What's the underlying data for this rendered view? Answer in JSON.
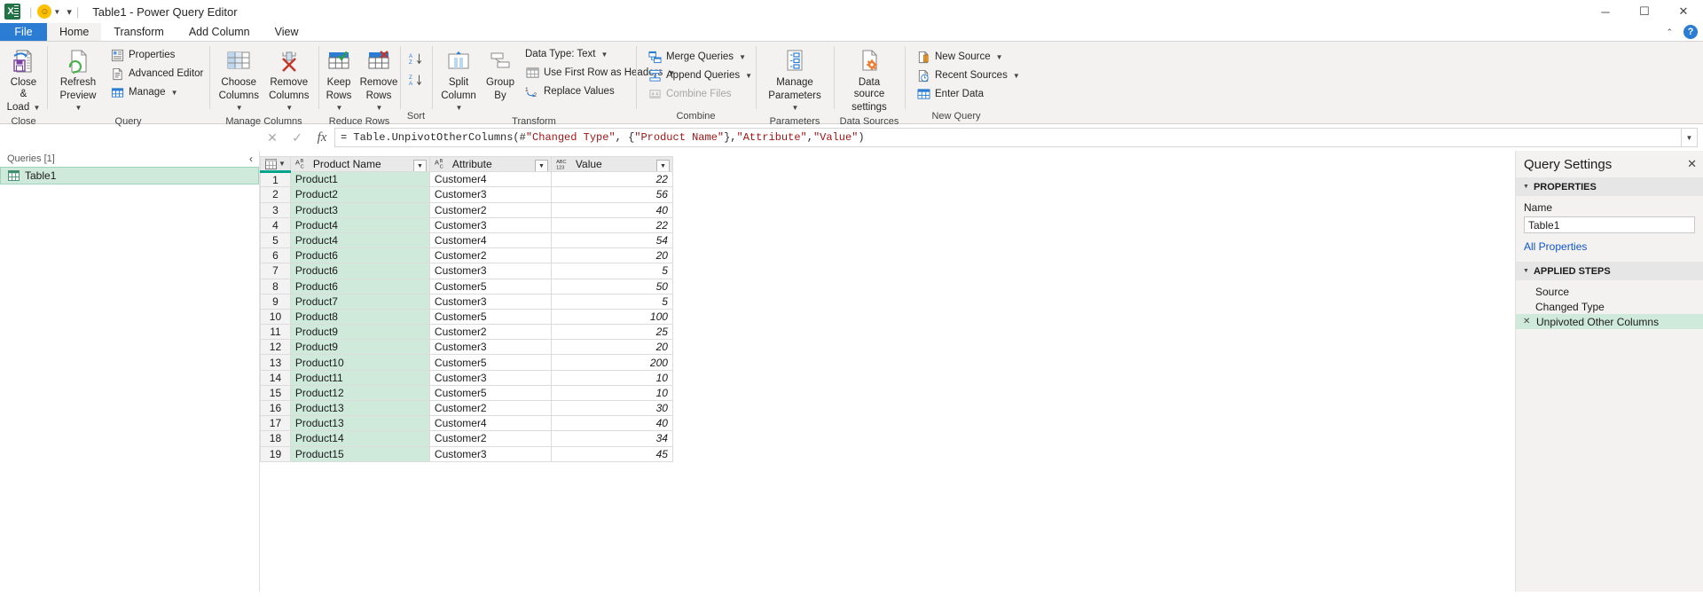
{
  "window": {
    "title": "Table1 - Power Query Editor",
    "app_icon": "excel-icon",
    "qat": {
      "autosave_icon": "smiley-icon",
      "customize_icon": "chevron-down-icon"
    },
    "buttons": {
      "minimize": "─",
      "maximize": "☐",
      "close": "✕"
    }
  },
  "tabs": [
    {
      "id": "file",
      "label": "File"
    },
    {
      "id": "home",
      "label": "Home"
    },
    {
      "id": "transform",
      "label": "Transform"
    },
    {
      "id": "add-column",
      "label": "Add Column"
    },
    {
      "id": "view",
      "label": "View"
    }
  ],
  "tabstrip_right": {
    "collapse": "⌃",
    "help": "?"
  },
  "ribbon": {
    "groups": [
      {
        "name": "Close",
        "label": "Close",
        "big": [
          {
            "label_line1": "Close &",
            "label_line2": "Load",
            "icon": "close-and-load-icon",
            "dropdown": true
          }
        ],
        "small": []
      },
      {
        "name": "Query",
        "label": "Query",
        "big": [
          {
            "label_line1": "Refresh",
            "label_line2": "Preview",
            "icon": "refresh-preview-icon",
            "dropdown": true
          }
        ],
        "small": [
          {
            "label": "Properties",
            "icon": "properties-icon",
            "dropdown": false
          },
          {
            "label": "Advanced Editor",
            "icon": "advanced-editor-icon",
            "dropdown": false
          },
          {
            "label": "Manage",
            "icon": "manage-icon",
            "dropdown": true
          }
        ]
      },
      {
        "name": "Manage Columns",
        "label": "Manage Columns",
        "big": [
          {
            "label_line1": "Choose",
            "label_line2": "Columns",
            "icon": "choose-columns-icon",
            "dropdown": true
          },
          {
            "label_line1": "Remove",
            "label_line2": "Columns",
            "icon": "remove-columns-icon",
            "dropdown": true
          }
        ],
        "small": []
      },
      {
        "name": "Reduce Rows",
        "label": "Reduce Rows",
        "big": [
          {
            "label_line1": "Keep",
            "label_line2": "Rows",
            "icon": "keep-rows-icon",
            "dropdown": true
          },
          {
            "label_line1": "Remove",
            "label_line2": "Rows",
            "icon": "remove-rows-icon",
            "dropdown": true
          }
        ],
        "small": []
      },
      {
        "name": "Sort",
        "label": "Sort",
        "big": [],
        "small": [
          {
            "label": "",
            "icon": "sort-ascending-icon",
            "dropdown": false
          },
          {
            "label": "",
            "icon": "sort-descending-icon",
            "dropdown": false
          }
        ]
      },
      {
        "name": "Transform",
        "label": "Transform",
        "big": [
          {
            "label_line1": "Split",
            "label_line2": "Column",
            "icon": "split-column-icon",
            "dropdown": true
          },
          {
            "label_line1": "Group",
            "label_line2": "By",
            "icon": "group-by-icon",
            "dropdown": false
          }
        ],
        "small": [
          {
            "label": "Data Type: Text",
            "icon": "",
            "dropdown": true
          },
          {
            "label": "Use First Row as Headers",
            "icon": "use-first-row-as-headers-icon",
            "dropdown": true
          },
          {
            "label": "Replace Values",
            "icon": "replace-values-icon",
            "dropdown": false
          }
        ]
      },
      {
        "name": "Combine",
        "label": "Combine",
        "big": [],
        "small": [
          {
            "label": "Merge Queries",
            "icon": "merge-queries-icon",
            "dropdown": true
          },
          {
            "label": "Append Queries",
            "icon": "append-queries-icon",
            "dropdown": true
          },
          {
            "label": "Combine Files",
            "icon": "combine-files-icon",
            "dropdown": false,
            "disabled": true
          }
        ]
      },
      {
        "name": "Parameters",
        "label": "Parameters",
        "big": [
          {
            "label_line1": "Manage",
            "label_line2": "Parameters",
            "icon": "manage-parameters-icon",
            "dropdown": true
          }
        ],
        "small": []
      },
      {
        "name": "Data Sources",
        "label": "Data Sources",
        "big": [
          {
            "label_line1": "Data source",
            "label_line2": "settings",
            "icon": "data-source-settings-icon",
            "dropdown": false
          }
        ],
        "small": []
      },
      {
        "name": "New Query",
        "label": "New Query",
        "big": [],
        "small": [
          {
            "label": "New Source",
            "icon": "new-source-icon",
            "dropdown": true
          },
          {
            "label": "Recent Sources",
            "icon": "recent-sources-icon",
            "dropdown": true
          },
          {
            "label": "Enter Data",
            "icon": "enter-data-icon",
            "dropdown": false
          }
        ]
      }
    ]
  },
  "formula_bar": {
    "cancel_icon": "cancel-icon",
    "confirm_icon": "checkmark-icon",
    "fx_icon": "fx-icon",
    "expand_icon": "chevron-down-icon",
    "prefix": "= Table.UnpivotOtherColumns(#",
    "value": "= Table.UnpivotOtherColumns(#\"Changed Type\", {\"Product Name\"}, \"Attribute\", \"Value\")",
    "tokens": [
      {
        "t": "= Table.UnpivotOtherColumns(#",
        "k": "fn"
      },
      {
        "t": "\"Changed Type\"",
        "k": "str"
      },
      {
        "t": ", {",
        "k": "fn"
      },
      {
        "t": "\"Product Name\"",
        "k": "str"
      },
      {
        "t": "}, ",
        "k": "fn"
      },
      {
        "t": "\"Attribute\"",
        "k": "str"
      },
      {
        "t": ", ",
        "k": "fn"
      },
      {
        "t": "\"Value\"",
        "k": "str"
      },
      {
        "t": ")",
        "k": "fn"
      }
    ]
  },
  "queries_pane": {
    "header": "Queries [1]",
    "collapse_icon": "chevron-left-icon",
    "items": [
      {
        "name": "Table1",
        "icon": "table-icon",
        "selected": true
      }
    ]
  },
  "grid": {
    "corner_icon": "select-all-table-icon",
    "columns": [
      {
        "name": "Product Name",
        "type_icon": "ABC",
        "type_r1": "Aᴮ",
        "type_r2": "C",
        "align": "left",
        "selected": true
      },
      {
        "name": "Attribute",
        "type_icon": "ABC",
        "type_r1": "Aᴮ",
        "type_r2": "C",
        "align": "left",
        "selected": false
      },
      {
        "name": "Value",
        "type_icon": "123",
        "type_r1": "ABC",
        "type_r2": "123",
        "align": "right",
        "selected": false
      }
    ],
    "rows": [
      {
        "n": 1,
        "product": "Product1",
        "attribute": "Customer4",
        "value": "22"
      },
      {
        "n": 2,
        "product": "Product2",
        "attribute": "Customer3",
        "value": "56"
      },
      {
        "n": 3,
        "product": "Product3",
        "attribute": "Customer2",
        "value": "40"
      },
      {
        "n": 4,
        "product": "Product4",
        "attribute": "Customer3",
        "value": "22"
      },
      {
        "n": 5,
        "product": "Product4",
        "attribute": "Customer4",
        "value": "54"
      },
      {
        "n": 6,
        "product": "Product6",
        "attribute": "Customer2",
        "value": "20"
      },
      {
        "n": 7,
        "product": "Product6",
        "attribute": "Customer3",
        "value": "5"
      },
      {
        "n": 8,
        "product": "Product6",
        "attribute": "Customer5",
        "value": "50"
      },
      {
        "n": 9,
        "product": "Product7",
        "attribute": "Customer3",
        "value": "5"
      },
      {
        "n": 10,
        "product": "Product8",
        "attribute": "Customer5",
        "value": "100"
      },
      {
        "n": 11,
        "product": "Product9",
        "attribute": "Customer2",
        "value": "25"
      },
      {
        "n": 12,
        "product": "Product9",
        "attribute": "Customer3",
        "value": "20"
      },
      {
        "n": 13,
        "product": "Product10",
        "attribute": "Customer5",
        "value": "200"
      },
      {
        "n": 14,
        "product": "Product11",
        "attribute": "Customer3",
        "value": "10"
      },
      {
        "n": 15,
        "product": "Product12",
        "attribute": "Customer5",
        "value": "10"
      },
      {
        "n": 16,
        "product": "Product13",
        "attribute": "Customer2",
        "value": "30"
      },
      {
        "n": 17,
        "product": "Product13",
        "attribute": "Customer4",
        "value": "40"
      },
      {
        "n": 18,
        "product": "Product14",
        "attribute": "Customer2",
        "value": "34"
      },
      {
        "n": 19,
        "product": "Product15",
        "attribute": "Customer3",
        "value": "45"
      }
    ]
  },
  "query_settings": {
    "title": "Query Settings",
    "close_icon": "close-icon",
    "properties_section": "PROPERTIES",
    "name_label": "Name",
    "name_value": "Table1",
    "all_properties_link": "All Properties",
    "applied_steps_section": "APPLIED STEPS",
    "steps": [
      {
        "label": "Source",
        "has_x": false,
        "selected": false
      },
      {
        "label": "Changed Type",
        "has_x": false,
        "selected": false
      },
      {
        "label": "Unpivoted Other Columns",
        "has_x": true,
        "selected": true
      }
    ]
  },
  "colors": {
    "accent_green": "#217346",
    "tab_blue": "#2b7cd3",
    "selection_green": "#cfe9db",
    "header_underline": "#00a38c"
  }
}
